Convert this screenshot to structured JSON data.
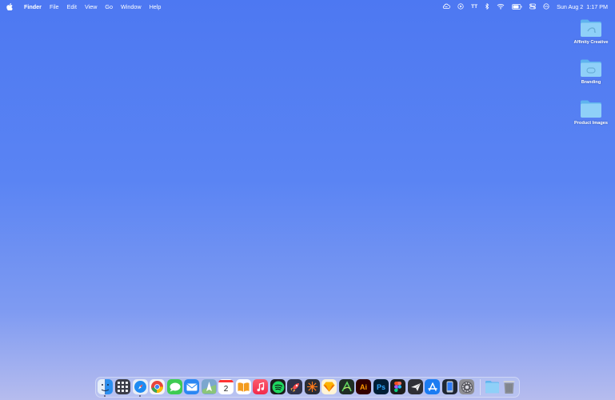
{
  "menubar": {
    "apple": "apple-logo",
    "app_name": "Finder",
    "menus": [
      "File",
      "Edit",
      "View",
      "Go",
      "Window",
      "Help"
    ],
    "status_icons": [
      "cloud-icon",
      "play-circle-icon",
      "tt-icon",
      "bluetooth-icon",
      "wifi-icon",
      "battery-icon",
      "control-center-icon",
      "siri-icon"
    ],
    "status_tt": "TT",
    "clock": "Sun Aug 2  1:17 PM"
  },
  "desktop": {
    "items": [
      {
        "label": "Affinity Creative"
      },
      {
        "label": "Branding"
      },
      {
        "label": "Product Images"
      }
    ]
  },
  "dock": {
    "apps": [
      {
        "name": "finder",
        "running": true
      },
      {
        "name": "launchpad"
      },
      {
        "name": "safari",
        "running": true
      },
      {
        "name": "chrome"
      },
      {
        "name": "messages"
      },
      {
        "name": "mail"
      },
      {
        "name": "maps"
      },
      {
        "name": "calendar",
        "text": "2"
      },
      {
        "name": "books"
      },
      {
        "name": "music"
      },
      {
        "name": "spotify"
      },
      {
        "name": "rocket"
      },
      {
        "name": "affinity"
      },
      {
        "name": "sketch"
      },
      {
        "name": "affinity-designer"
      },
      {
        "name": "illustrator",
        "text": "Ai"
      },
      {
        "name": "photoshop",
        "text": "Ps"
      },
      {
        "name": "figma"
      },
      {
        "name": "paper-plane"
      },
      {
        "name": "xcode-instruments"
      },
      {
        "name": "simulator"
      },
      {
        "name": "system-preferences"
      },
      {
        "name": "downloads-folder"
      },
      {
        "name": "trash"
      }
    ]
  }
}
